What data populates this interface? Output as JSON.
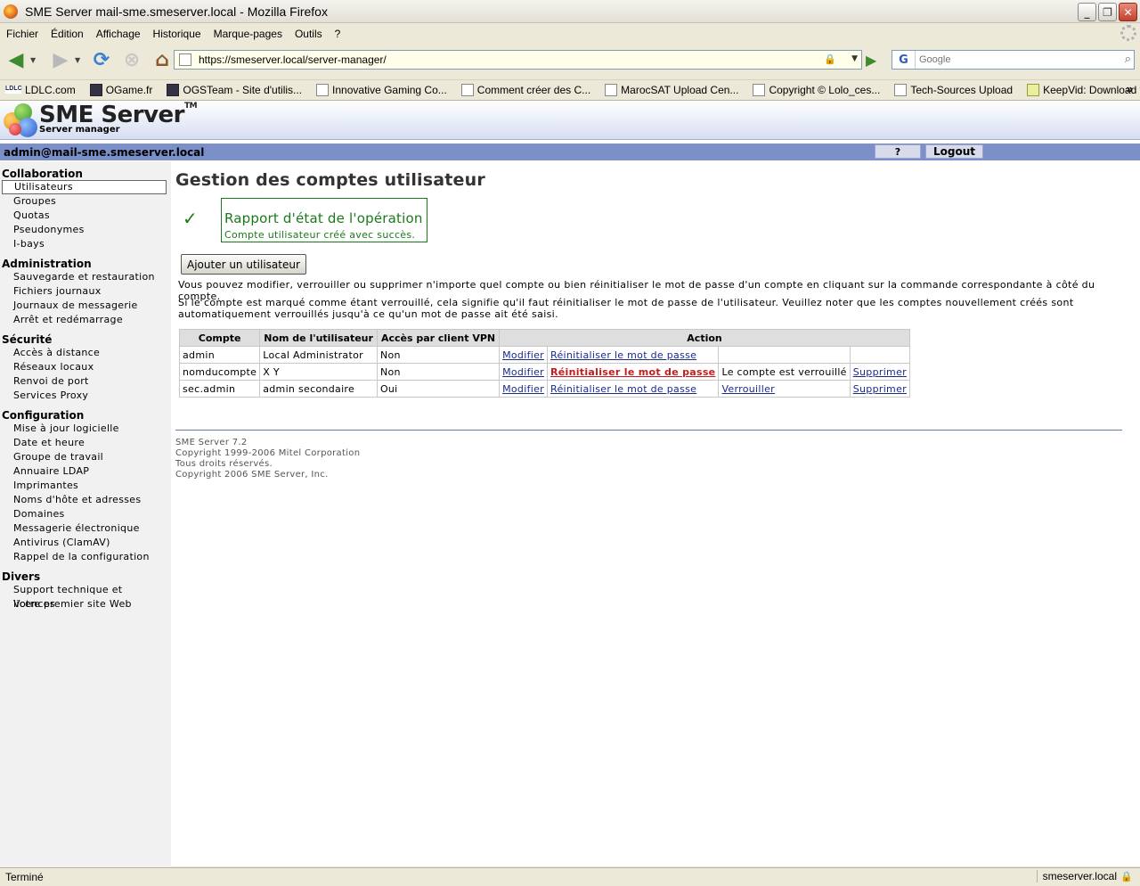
{
  "window": {
    "title": "SME Server mail-sme.smeserver.local - Mozilla Firefox",
    "minimize": "_",
    "restore": "❐",
    "close": "✕"
  },
  "menu": [
    "Fichier",
    "Édition",
    "Affichage",
    "Historique",
    "Marque-pages",
    "Outils",
    "?"
  ],
  "nav": {
    "url": "https://smeserver.local/server-manager/",
    "search_placeholder": "Google",
    "search_engine_glyph": "G"
  },
  "bookmarks": [
    {
      "label": "LDLC.com",
      "icon": "ldlc-icon"
    },
    {
      "label": "OGame.fr",
      "icon": "ogame-icon"
    },
    {
      "label": "OGSTeam - Site d'utilis...",
      "icon": "ogsteam-icon"
    },
    {
      "label": "Innovative Gaming Co...",
      "icon": "page-icon"
    },
    {
      "label": "Comment créer des C...",
      "icon": "page-icon"
    },
    {
      "label": "MarocSAT Upload Cen...",
      "icon": "page-icon"
    },
    {
      "label": "Copyright © Lolo_ces...",
      "icon": "page-icon"
    },
    {
      "label": "Tech-Sources Upload",
      "icon": "page-icon"
    },
    {
      "label": "KeepVid: Download vi...",
      "icon": "keepvid-icon"
    }
  ],
  "header": {
    "logo_text": "SME Server",
    "logo_tm": "TM",
    "logo_sub": "Server manager",
    "user": "admin@mail-sme.smeserver.local",
    "help": "?",
    "logout": "Logout"
  },
  "sidebar": [
    {
      "heading": "Collaboration",
      "items": [
        "Utilisateurs",
        "Groupes",
        "Quotas",
        "Pseudonymes",
        "I-bays"
      ]
    },
    {
      "heading": "Administration",
      "items": [
        "Sauvegarde et restauration",
        "Fichiers journaux",
        "Journaux de messagerie",
        "Arrêt et redémarrage"
      ]
    },
    {
      "heading": "Sécurité",
      "items": [
        "Accès à distance",
        "Réseaux locaux",
        "Renvoi de port",
        "Services Proxy"
      ]
    },
    {
      "heading": "Configuration",
      "items": [
        "Mise à jour logicielle",
        "Date et heure",
        "Groupe de travail",
        "Annuaire LDAP",
        "Imprimantes",
        "Noms d'hôte et adresses",
        "Domaines",
        "Messagerie électronique",
        "Antivirus (ClamAV)",
        "Rappel de la configuration"
      ]
    },
    {
      "heading": "Divers",
      "items": [
        "Support technique et licences",
        "Votre premier site Web"
      ]
    }
  ],
  "main": {
    "title": "Gestion des comptes utilisateur",
    "check": "✓",
    "report_title": "Rapport d'état de l'opération",
    "report_msg": "Compte utilisateur créé avec succès.",
    "add_button": "Ajouter un utilisateur",
    "para1": "Vous pouvez modifier, verrouiller ou supprimer n'importe quel compte ou bien réinitialiser le mot de passe d'un compte en cliquant sur la commande correspondante à côté du compte.",
    "para2": "Si le compte est marqué comme étant verrouillé, cela signifie qu'il faut réinitialiser le mot de passe de l'utilisateur. Veuillez noter que les comptes nouvellement créés sont automatiquement verrouillés jusqu'à ce qu'un mot de passe ait été saisi.",
    "table": {
      "headers": [
        "Compte",
        "Nom de l'utilisateur",
        "Accès par client VPN",
        "Action"
      ],
      "rows": [
        {
          "account": "admin",
          "name": "Local Administrator",
          "vpn": "Non",
          "modify": "Modifier",
          "reset": "Réinitialiser le mot de passe",
          "lock": "",
          "delete": ""
        },
        {
          "account": "nomducompte",
          "name": "X Y",
          "vpn": "Non",
          "modify": "Modifier",
          "reset": "Réinitialiser le mot de passe",
          "lock": "Le compte est verrouillé",
          "delete": "Supprimer"
        },
        {
          "account": "sec.admin",
          "name": "admin secondaire",
          "vpn": "Oui",
          "modify": "Modifier",
          "reset": "Réinitialiser le mot de passe",
          "lock": "Verrouiller",
          "delete": "Supprimer"
        }
      ]
    },
    "footer": [
      "SME Server 7.2",
      "Copyright 1999-2006 Mitel Corporation",
      "Tous droits réservés.",
      "Copyright 2006 SME Server, Inc."
    ]
  },
  "status": {
    "text": "Terminé",
    "host": "smeserver.local"
  }
}
